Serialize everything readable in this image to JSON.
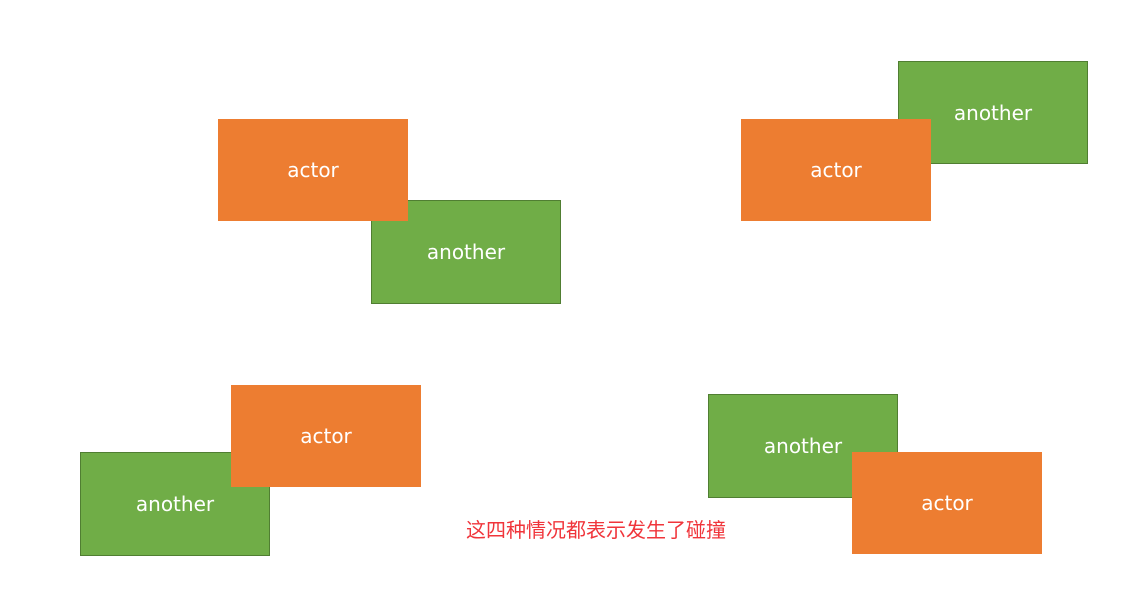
{
  "colors": {
    "actor_fill": "#ed7d31",
    "another_fill": "#70ad47",
    "another_border": "#507e32",
    "label_text": "#ffffff",
    "caption_text": "#f0353b"
  },
  "scenarios": [
    {
      "name": "actor-top-left-overlap",
      "actor": {
        "label": "actor"
      },
      "another": {
        "label": "another"
      }
    },
    {
      "name": "actor-bottom-left-overlap",
      "actor": {
        "label": "actor"
      },
      "another": {
        "label": "another"
      }
    },
    {
      "name": "actor-top-right-overlap",
      "actor": {
        "label": "actor"
      },
      "another": {
        "label": "another"
      }
    },
    {
      "name": "actor-bottom-right-overlap",
      "actor": {
        "label": "actor"
      },
      "another": {
        "label": "another"
      }
    }
  ],
  "caption": "这四种情况都表示发生了碰撞"
}
